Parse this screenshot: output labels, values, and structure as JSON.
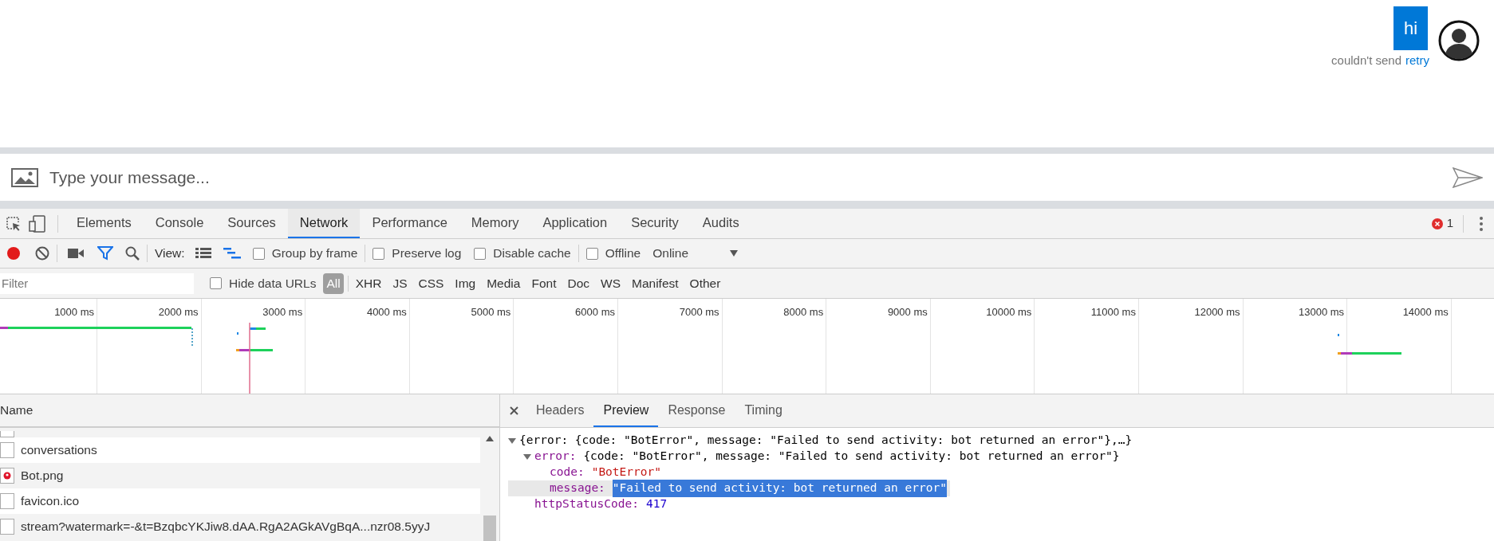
{
  "chat": {
    "messages": [
      {
        "text": "hi",
        "status": "couldn't send",
        "action": "retry",
        "failed": true
      }
    ],
    "input": {
      "placeholder": "Type your message..."
    }
  },
  "devtools": {
    "tabs": [
      {
        "label": "Elements",
        "selected": false
      },
      {
        "label": "Console",
        "selected": false
      },
      {
        "label": "Sources",
        "selected": false
      },
      {
        "label": "Network",
        "selected": true
      },
      {
        "label": "Performance",
        "selected": false
      },
      {
        "label": "Memory",
        "selected": false
      },
      {
        "label": "Application",
        "selected": false
      },
      {
        "label": "Security",
        "selected": false
      },
      {
        "label": "Audits",
        "selected": false
      }
    ],
    "error_count": "1",
    "toolbar": {
      "recording": true,
      "filter_on": true,
      "view_label": "View:",
      "large_rows": false,
      "waterfall_on": true,
      "options": [
        {
          "label": "Group by frame",
          "checked": false
        },
        {
          "label": "Preserve log",
          "checked": false
        },
        {
          "label": "Disable cache",
          "checked": false
        },
        {
          "label": "Offline",
          "checked": false
        }
      ],
      "throttling": "Online"
    },
    "filter": {
      "placeholder": "Filter",
      "hide_data_urls": {
        "label": "Hide data URLs",
        "checked": false
      },
      "types": [
        {
          "label": "All",
          "selected": true
        },
        {
          "label": "XHR",
          "selected": false
        },
        {
          "label": "JS",
          "selected": false
        },
        {
          "label": "CSS",
          "selected": false
        },
        {
          "label": "Img",
          "selected": false
        },
        {
          "label": "Media",
          "selected": false
        },
        {
          "label": "Font",
          "selected": false
        },
        {
          "label": "Doc",
          "selected": false
        },
        {
          "label": "WS",
          "selected": false
        },
        {
          "label": "Manifest",
          "selected": false
        },
        {
          "label": "Other",
          "selected": false
        }
      ]
    },
    "timeline": {
      "ticks": [
        "1000 ms",
        "2000 ms",
        "3000 ms",
        "4000 ms",
        "5000 ms",
        "6000 ms",
        "7000 ms",
        "8000 ms",
        "9000 ms",
        "10000 ms",
        "11000 ms",
        "12000 ms",
        "13000 ms",
        "14000 ms"
      ]
    },
    "requests": {
      "column": "Name",
      "rows": [
        {
          "name": "conversations",
          "kind": "file"
        },
        {
          "name": "Bot.png",
          "kind": "image"
        },
        {
          "name": "favicon.ico",
          "kind": "file"
        },
        {
          "name": "stream?watermark=-&t=BzqbcYKJiw8.dAA.RgA2AGkAVgBqA...nzr08.5yyJ",
          "kind": "file"
        }
      ]
    },
    "details": {
      "tabs": [
        {
          "label": "Headers",
          "selected": false
        },
        {
          "label": "Preview",
          "selected": true
        },
        {
          "label": "Response",
          "selected": false
        },
        {
          "label": "Timing",
          "selected": false
        }
      ],
      "preview": {
        "text": "{error: {code: \"BotError\", message: \"Failed to send activity: bot returned an error\"},…}",
        "expanded": true,
        "children": [
          {
            "key": "error:",
            "kind": "object",
            "text": "{code: \"BotError\", message: \"Failed to send activity: bot returned an error\"}",
            "expanded": true,
            "children": [
              {
                "key": "code:",
                "kind": "string",
                "text": "\"BotError\"",
                "selected": false
              },
              {
                "key": "message:",
                "kind": "string",
                "text": "\"Failed to send activity: bot returned an error\"",
                "selected": true
              }
            ]
          },
          {
            "key": "httpStatusCode:",
            "kind": "number",
            "text": "417",
            "selected": false
          }
        ]
      }
    }
  }
}
